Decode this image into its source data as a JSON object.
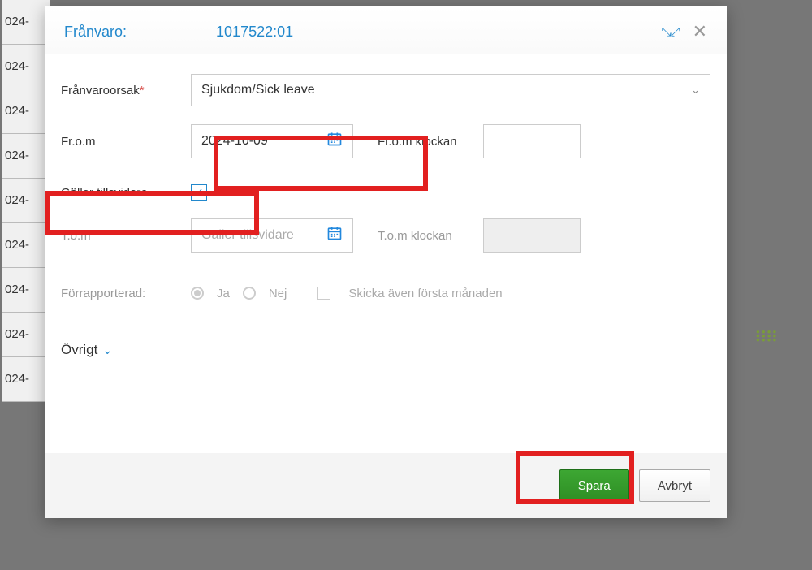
{
  "bg_item": "024-",
  "header": {
    "title": "Frånvaro:",
    "id": "1017522:01"
  },
  "form": {
    "reason_label": "Frånvaroorsak",
    "reason_value": "Sjukdom/Sick leave",
    "from_label": "Fr.o.m",
    "from_date": "2024-10-09",
    "from_time_label": "Fr.o.m klockan",
    "tillsvidare_label": "Gäller tillsvidare",
    "tillsvidare_checked": true,
    "to_label": "T.o.m",
    "to_placeholder": "Gäller tillsvidare",
    "to_time_label": "T.o.m klockan",
    "forrapporterad_label": "Förrapporterad:",
    "ja": "Ja",
    "nej": "Nej",
    "send_first_month": "Skicka även första månaden",
    "ovrigt": "Övrigt"
  },
  "buttons": {
    "save": "Spara",
    "cancel": "Avbryt"
  }
}
